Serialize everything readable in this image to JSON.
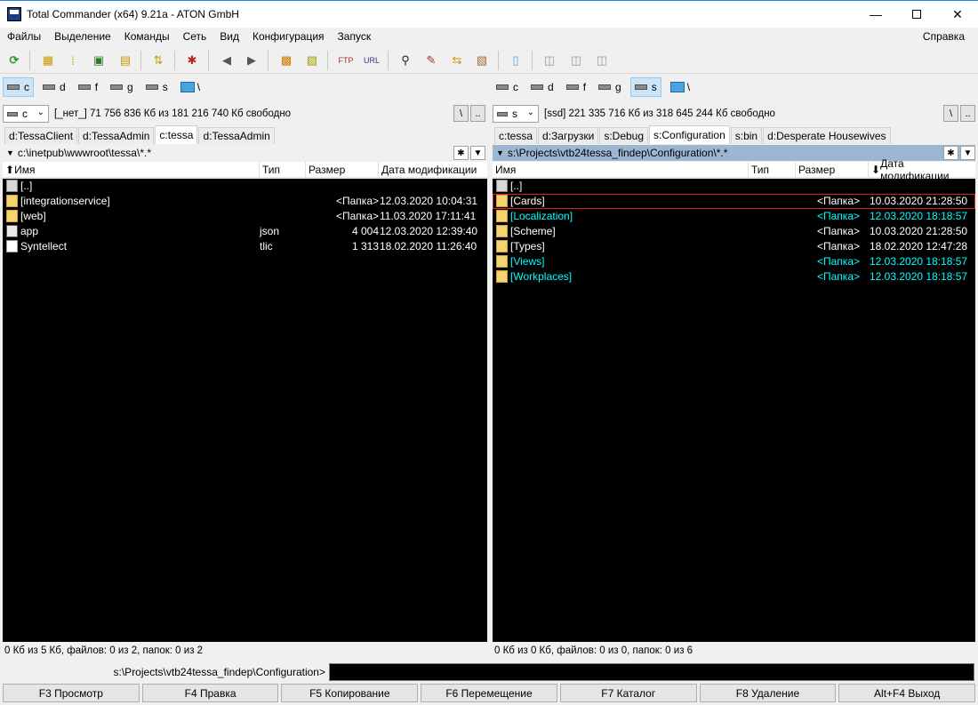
{
  "window": {
    "title": "Total Commander (x64) 9.21a - ATON GmbH"
  },
  "menu": {
    "items": [
      "Файлы",
      "Выделение",
      "Команды",
      "Сеть",
      "Вид",
      "Конфигурация",
      "Запуск"
    ],
    "help": "Справка"
  },
  "left": {
    "drives": [
      "c",
      "d",
      "f",
      "g",
      "s",
      "\\"
    ],
    "selected_drive": "c",
    "drive_combo": "c",
    "info": "[_нет_]  71 756 836 Кб из 181 216 740 Кб свободно",
    "tabs": [
      "d:TessaClient",
      "d:TessaAdmin",
      "c:tessa",
      "d:TessaAdmin"
    ],
    "active_tab": 2,
    "path": "c:\\inetpub\\wwwroot\\tessa\\*.*",
    "columns": [
      "Имя",
      "Тип",
      "Размер",
      "Дата модификации"
    ],
    "sort_indicator": "⬆",
    "rows": [
      {
        "name": "[..]",
        "type": "",
        "size": "",
        "date": "",
        "icon": "up"
      },
      {
        "name": "[integrationservice]",
        "type": "",
        "size": "<Папка>",
        "date": "12.03.2020 10:04:31",
        "icon": "folder"
      },
      {
        "name": "[web]",
        "type": "",
        "size": "<Папка>",
        "date": "11.03.2020 17:11:41",
        "icon": "folder"
      },
      {
        "name": "app",
        "type": "json",
        "size": "4 004",
        "date": "12.03.2020 12:39:40",
        "icon": "exe"
      },
      {
        "name": "Syntellect",
        "type": "tlic",
        "size": "1 313",
        "date": "18.02.2020 11:26:40",
        "icon": "file"
      }
    ],
    "status": "0 Кб из 5 Кб, файлов: 0 из 2, папок: 0 из 2"
  },
  "right": {
    "drives": [
      "c",
      "d",
      "f",
      "g",
      "s",
      "\\"
    ],
    "selected_drive": "s",
    "drive_combo": "s",
    "info": "[ssd]  221 335 716 Кб из 318 645 244 Кб свободно",
    "tabs": [
      "c:tessa",
      "d:Загрузки",
      "s:Debug",
      "s:Configuration",
      "s:bin",
      "d:Desperate Housewives"
    ],
    "active_tab": 3,
    "path": "s:\\Projects\\vtb24tessa_findep\\Configuration\\*.*",
    "columns": [
      "Имя",
      "Тип",
      "Размер",
      "Дата модификации"
    ],
    "sort_indicator": "⬇",
    "rows": [
      {
        "name": "[..]",
        "type": "",
        "size": "",
        "date": "",
        "icon": "up",
        "highlight": false
      },
      {
        "name": "[Cards]",
        "type": "",
        "size": "<Папка>",
        "date": "10.03.2020 21:28:50",
        "icon": "folder",
        "highlight": false,
        "cursor": true
      },
      {
        "name": "[Localization]",
        "type": "",
        "size": "<Папка>",
        "date": "12.03.2020 18:18:57",
        "icon": "folder",
        "highlight": true
      },
      {
        "name": "[Scheme]",
        "type": "",
        "size": "<Папка>",
        "date": "10.03.2020 21:28:50",
        "icon": "folder",
        "highlight": false
      },
      {
        "name": "[Types]",
        "type": "",
        "size": "<Папка>",
        "date": "18.02.2020 12:47:28",
        "icon": "folder",
        "highlight": false
      },
      {
        "name": "[Views]",
        "type": "",
        "size": "<Папка>",
        "date": "12.03.2020 18:18:57",
        "icon": "folder",
        "highlight": true
      },
      {
        "name": "[Workplaces]",
        "type": "",
        "size": "<Папка>",
        "date": "12.03.2020 18:18:57",
        "icon": "folder",
        "highlight": true
      }
    ],
    "status": "0 Кб из 0 Кб, файлов: 0 из 0, папок: 0 из 6"
  },
  "cmdline": {
    "label": "s:\\Projects\\vtb24tessa_findep\\Configuration>",
    "value": ""
  },
  "fkeys": [
    "F3 Просмотр",
    "F4 Правка",
    "F5 Копирование",
    "F6 Перемещение",
    "F7 Каталог",
    "F8 Удаление",
    "Alt+F4 Выход"
  ],
  "colors": {
    "highlight": "#00ffff",
    "file_text": "#ffffff",
    "panel_bg": "#000000",
    "cursor_border": "#e02020",
    "active_path_bg": "#9db6d4"
  }
}
